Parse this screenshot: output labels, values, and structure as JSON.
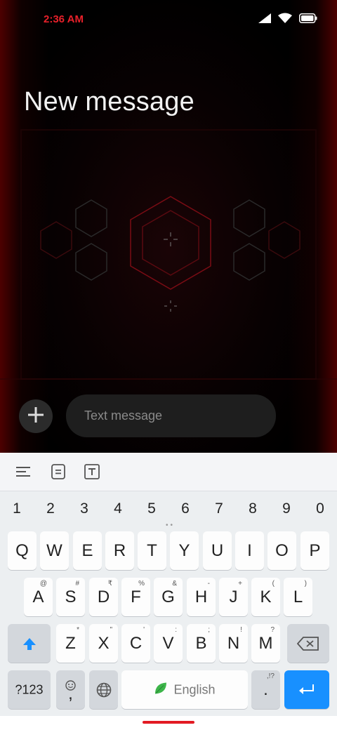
{
  "status_bar": {
    "time": "2:36 AM"
  },
  "header": {
    "title": "New message"
  },
  "composer": {
    "placeholder": "Text message"
  },
  "keyboard": {
    "numbers": [
      "1",
      "2",
      "3",
      "4",
      "5",
      "6",
      "7",
      "8",
      "9",
      "0"
    ],
    "row1": [
      "Q",
      "W",
      "E",
      "R",
      "T",
      "Y",
      "U",
      "I",
      "O",
      "P"
    ],
    "row2": [
      {
        "key": "A",
        "hint": "@"
      },
      {
        "key": "S",
        "hint": "#"
      },
      {
        "key": "D",
        "hint": "₹"
      },
      {
        "key": "F",
        "hint": "%"
      },
      {
        "key": "G",
        "hint": "&"
      },
      {
        "key": "H",
        "hint": "-"
      },
      {
        "key": "J",
        "hint": "+"
      },
      {
        "key": "K",
        "hint": "("
      },
      {
        "key": "L",
        "hint": ")"
      }
    ],
    "row3": [
      {
        "key": "Z",
        "hint": "*"
      },
      {
        "key": "X",
        "hint": "\""
      },
      {
        "key": "C",
        "hint": "'"
      },
      {
        "key": "V",
        "hint": ":"
      },
      {
        "key": "B",
        "hint": ";"
      },
      {
        "key": "N",
        "hint": "!"
      },
      {
        "key": "M",
        "hint": "?"
      }
    ],
    "symbols_label": "?123",
    "comma_label": ",",
    "space_label": "English",
    "period_label": ".",
    "period_hint": ",!?"
  },
  "colors": {
    "accent": "#1890ff",
    "time_red": "#e8202a"
  }
}
